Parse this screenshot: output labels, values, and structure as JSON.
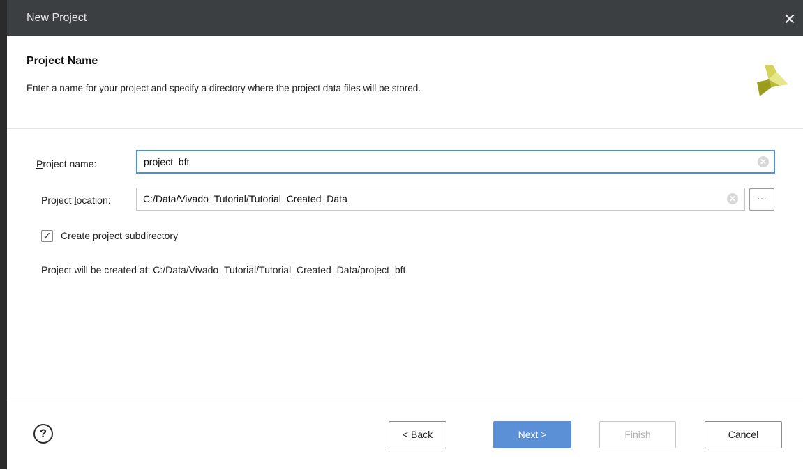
{
  "window": {
    "title": "New Project",
    "close_glyph": "✕"
  },
  "header": {
    "title": "Project Name",
    "description": "Enter a name for your project and specify a directory where the project data files will be stored.",
    "logo_icon": "vivado-logo-icon",
    "logo_colors": [
      "#c8c83a",
      "#9a9a1e",
      "#e0e070",
      "#7d7d10"
    ]
  },
  "form": {
    "project_name_label_mnemonic": "P",
    "project_name_label_rest": "roject name:",
    "project_name_value": "project_bft",
    "project_location_label_pre": "Project ",
    "project_location_label_mnemonic": "l",
    "project_location_label_post": "ocation:",
    "project_location_value": "C:/Data/Vivado_Tutorial/Tutorial_Created_Data",
    "browse_label": "···",
    "clear_glyph": "✕",
    "create_subdir_checked": true,
    "check_glyph": "✓",
    "create_subdir_label": "Create project subdirectory",
    "created_at_text": "Project will be created at: C:/Data/Vivado_Tutorial/Tutorial_Created_Data/project_bft"
  },
  "footer": {
    "help_glyph": "?",
    "back_prefix": "< ",
    "back_mnemonic": "B",
    "back_rest": "ack",
    "next_mnemonic": "N",
    "next_rest": "ext >",
    "finish_mnemonic": "F",
    "finish_rest": "inish",
    "cancel_label": "Cancel"
  },
  "colors": {
    "titlebar": "#3c3f41",
    "focus_border": "#4a90e2",
    "primary_button": "#5b8fd6"
  }
}
